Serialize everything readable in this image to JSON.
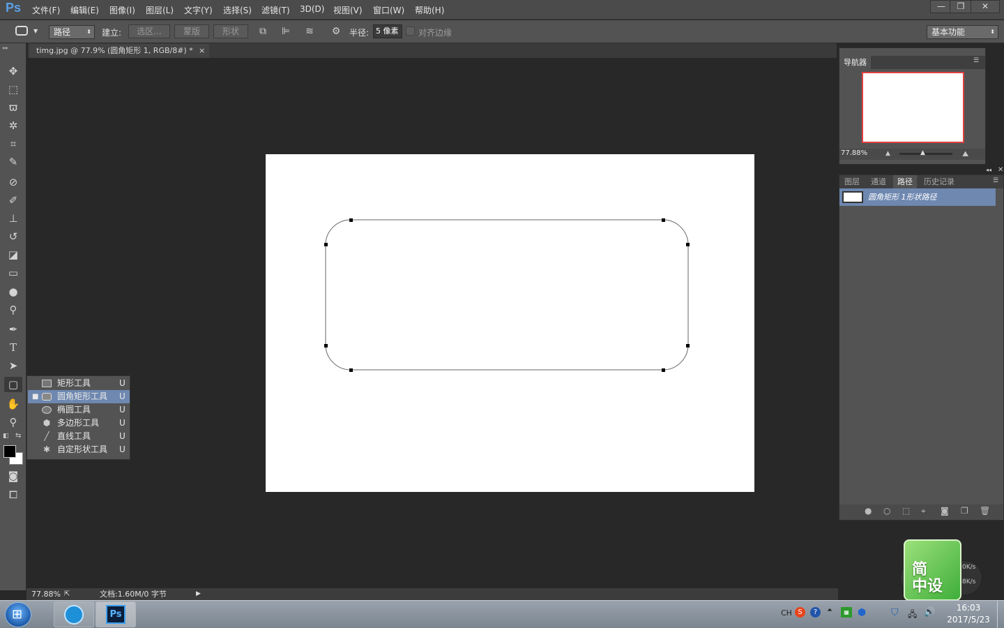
{
  "app": {
    "logo": "Ps"
  },
  "menu": [
    "文件(F)",
    "编辑(E)",
    "图像(I)",
    "图层(L)",
    "文字(Y)",
    "选择(S)",
    "滤镜(T)",
    "3D(D)",
    "视图(V)",
    "窗口(W)",
    "帮助(H)"
  ],
  "window_controls": {
    "minimize": "—",
    "restore": "❐",
    "close": "✕"
  },
  "options_bar": {
    "mode_value": "路径",
    "build_label": "建立:",
    "selection_btn": "选区...",
    "mask_btn": "蒙版",
    "shape_btn": "形状",
    "radius_label": "半径:",
    "radius_value": "5 像素",
    "align_edges_label": "对齐边缘",
    "workspace_value": "基本功能"
  },
  "document_tab": {
    "title": "timg.jpg @ 77.9% (圆角矩形 1, RGB/8#) *",
    "close": "×"
  },
  "tools": [
    "move-tool",
    "marquee-tool",
    "lasso-tool",
    "magic-wand-tool",
    "crop-tool",
    "eyedropper-tool",
    "healing-brush-tool",
    "brush-tool",
    "clone-stamp-tool",
    "history-brush-tool",
    "eraser-tool",
    "gradient-tool",
    "blur-tool",
    "dodge-tool",
    "pen-tool",
    "type-tool",
    "path-selection-tool",
    "shape-tool",
    "hand-tool",
    "zoom-tool"
  ],
  "flyout": {
    "items": [
      {
        "label": "矩形工具",
        "key": "U",
        "icon": "rectangle-icon",
        "active": false
      },
      {
        "label": "圆角矩形工具",
        "key": "U",
        "icon": "rounded-rectangle-icon",
        "active": true
      },
      {
        "label": "椭圆工具",
        "key": "U",
        "icon": "ellipse-icon",
        "active": false
      },
      {
        "label": "多边形工具",
        "key": "U",
        "icon": "polygon-icon",
        "active": false
      },
      {
        "label": "直线工具",
        "key": "U",
        "icon": "line-icon",
        "active": false
      },
      {
        "label": "自定形状工具",
        "key": "U",
        "icon": "custom-shape-icon",
        "active": false
      }
    ]
  },
  "status_bar": {
    "zoom": "77.88%",
    "doc_info": "文档:1.60M/0 字节"
  },
  "navigator": {
    "title": "导航器",
    "zoom": "77.88%"
  },
  "layers_panel": {
    "tabs": [
      "图层",
      "通道",
      "路径",
      "历史记录"
    ],
    "active_tab": "路径",
    "path_item": "圆角矩形 1形状路径"
  },
  "taskbar": {
    "tray_lang": "CH",
    "time": "16:03",
    "date": "2017/5/23",
    "net_up": "0K/s",
    "net_down": "8K/s"
  },
  "widget": {
    "line1": "简",
    "line2": "中设"
  }
}
